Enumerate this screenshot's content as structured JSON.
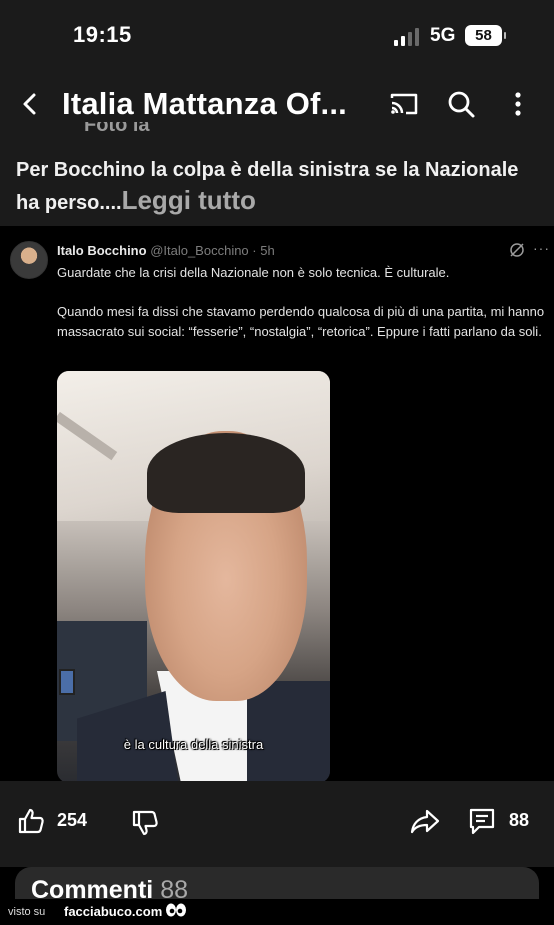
{
  "status_bar": {
    "time": "19:15",
    "network": "5G",
    "battery": "58"
  },
  "app_bar": {
    "title": "Italia Mattanza Of..."
  },
  "post": {
    "hidden_header": "Foto la",
    "body": "Per Bocchino la colpa è della sinistra se la Nazionale ha perso....",
    "read_more": "Leggi tutto"
  },
  "tweet": {
    "author": "Italo Bocchino",
    "handle": "@Italo_Bocchino",
    "time": "· 5h",
    "more": "···",
    "paragraph1": "Guardate che la crisi della Nazionale non è solo tecnica. È culturale.",
    "paragraph2": "Quando mesi fa dissi che stavamo perdendo qualcosa di più di una partita, mi hanno massacrato sui social: “fesserie”, “nostalgia”, “retorica”. Eppure i fatti parlano da soli.",
    "video_caption": "è la cultura della sinistra"
  },
  "actions": {
    "likes": "254",
    "comments": "88"
  },
  "comments_section": {
    "title": "Commenti",
    "count": "88"
  },
  "watermark": {
    "prefix": "visto su",
    "site": "facciabuco.com"
  },
  "colors": {
    "background": "#000000",
    "panel": "#1b1b1b",
    "card": "#2a2a2a",
    "muted_text": "#a9a9a9"
  },
  "icons": [
    "back-icon",
    "cast-icon",
    "search-icon",
    "more-icon",
    "grok-icon",
    "like-icon",
    "dislike-icon",
    "share-icon",
    "comment-icon"
  ]
}
